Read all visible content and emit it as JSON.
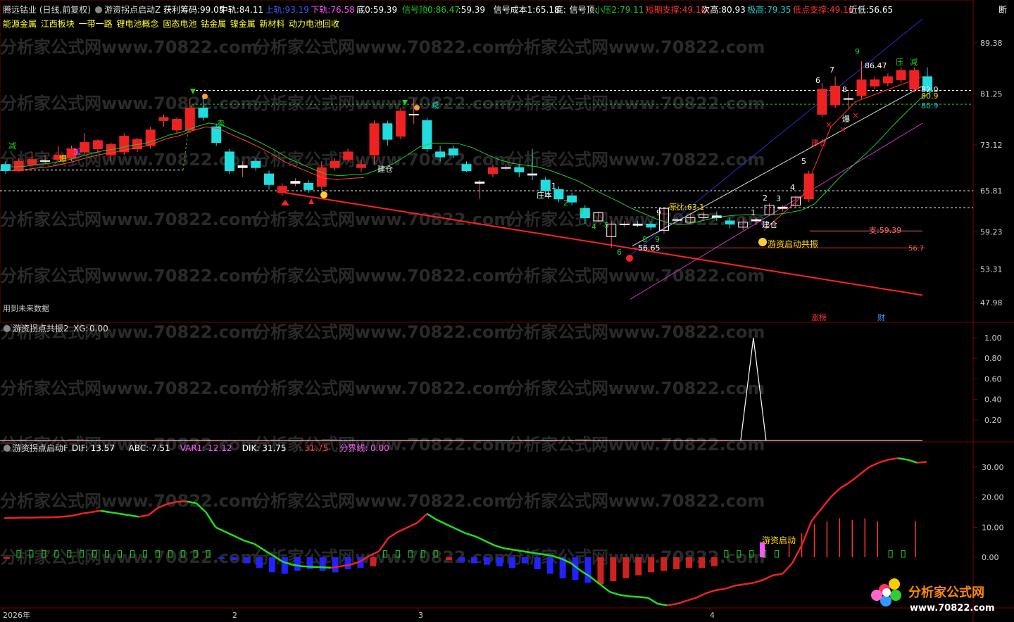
{
  "header": {
    "title": "腾远钴业 (日线,前复权)",
    "indicator_name": "游资拐点启动Z",
    "items": [
      {
        "label": "获利筹码:",
        "value": "99.05",
        "color": "#ffffff"
      },
      {
        "label": "中轨:",
        "value": "84.11",
        "color": "#ffffff"
      },
      {
        "label": "上轨:",
        "value": "93.19",
        "color": "#3b5bff"
      },
      {
        "label": "下轨:",
        "value": "76.58",
        "color": "#ff55ff"
      },
      {
        "label": "底0:",
        "value": "59.39",
        "color": "#ffffff"
      },
      {
        "label": "信号顶0:",
        "value": "86.47",
        "color": "#22cc22"
      },
      {
        "label": ":",
        "value": "59.39",
        "color": "#ffffff"
      },
      {
        "label": "信号成本1:",
        "value": "65.18",
        "color": "#ffffff"
      },
      {
        "label": "底:",
        "value": "",
        "color": "#ffffff"
      },
      {
        "label": "信号顶:",
        "value": "",
        "color": "#ffffff"
      },
      {
        "label": "小压2:",
        "value": "79.11",
        "color": "#22cc22"
      },
      {
        "label": "短期支撑:",
        "value": "49.16",
        "color": "#ff3333"
      },
      {
        "label": "次高:",
        "value": "80.93",
        "color": "#ffffff"
      },
      {
        "label": "极高:",
        "value": "79.35",
        "color": "#22cccc"
      },
      {
        "label": "低点支撑:",
        "value": "49.16",
        "color": "#ff3333"
      },
      {
        "label": "近低:",
        "value": "56.65",
        "color": "#ffffff"
      }
    ],
    "tail": "断"
  },
  "concepts": [
    "能源金属",
    "江西板块",
    "一带一路",
    "锂电池概念",
    "固态电池",
    "钴金属",
    "镍金属",
    "新材料",
    "动力电池回收"
  ],
  "watermark": "分析家公式网www.70822.com",
  "logo": {
    "name": "分析家公式网",
    "url": "www.70822.com"
  },
  "future_note": "用到未来数据",
  "bottom_tags": {
    "zhangbang": "涨榜",
    "cai": "财"
  },
  "panel2": {
    "name": "游资拐点共振2",
    "label": "XG:",
    "value": "0.00"
  },
  "panel3": {
    "name": "游资拐点启动F",
    "items": [
      {
        "label": "DIF:",
        "value": "13.57",
        "color": "#ffffff"
      },
      {
        "label": "ABC:",
        "value": "7.51",
        "color": "#ffffff"
      },
      {
        "label": "VAR1:",
        "value": "12.12",
        "color": "#ff55ff"
      },
      {
        "label": "DIK:",
        "value": "31.75",
        "color": "#ffffff"
      },
      {
        "label": ":",
        "value": "31.75",
        "color": "#ff3333"
      },
      {
        "label": "分界线:",
        "value": "0.00",
        "color": "#ff55ff"
      }
    ]
  },
  "axis": {
    "main_ticks": [
      "89.38",
      "81.25",
      "73.12",
      "65.81",
      "59.23",
      "53.31",
      "47.98"
    ],
    "panel2_ticks": [
      "1.00",
      "0.80",
      "0.60",
      "0.40",
      "0.20"
    ],
    "panel3_ticks": [
      "30.00",
      "20.00",
      "10.00",
      "0.00"
    ],
    "x_labels": [
      "2026年",
      "2",
      "3",
      "4"
    ]
  },
  "annotations": {
    "low_price": "56.65",
    "high_price": "86.47",
    "support": "支:59.39",
    "level_567": "56.7",
    "level_820": "82.0",
    "level_809a": "80.9",
    "level_809b": "80.9",
    "yuanbi": "原比:63.1",
    "yz_resonance": "游资启动共振",
    "yz_start": "游资启动",
    "jiancang1": "建仓",
    "jiancang2": "建仓",
    "jiancang3": "建仓",
    "zhuangben": "庄本",
    "bao1": "爆",
    "bao2": "爆",
    "jian1": "减",
    "jian2": "减",
    "jian3": "减",
    "mai": "卖",
    "ya": "压",
    "jia": "加"
  },
  "chart_data": {
    "type": "candlestick",
    "main_y_range": [
      47.98,
      89.38
    ],
    "candles": [
      {
        "o": 70.0,
        "c": 69.0,
        "h": 70.5,
        "l": 68.5
      },
      {
        "o": 69.0,
        "c": 70.5,
        "h": 71.0,
        "l": 68.8
      },
      {
        "o": 70.0,
        "c": 70.8,
        "h": 72.0,
        "l": 69.5
      },
      {
        "o": 70.5,
        "c": 70.6,
        "h": 71.5,
        "l": 70.0
      },
      {
        "o": 70.8,
        "c": 71.5,
        "h": 73.0,
        "l": 70.5
      },
      {
        "o": 71.0,
        "c": 72.5,
        "h": 73.0,
        "l": 70.5
      },
      {
        "o": 72.0,
        "c": 73.5,
        "h": 75.0,
        "l": 71.5
      },
      {
        "o": 72.5,
        "c": 73.8,
        "h": 74.0,
        "l": 72.0
      },
      {
        "o": 71.5,
        "c": 73.2,
        "h": 73.5,
        "l": 70.5
      },
      {
        "o": 72.0,
        "c": 74.5,
        "h": 75.0,
        "l": 71.5
      },
      {
        "o": 72.5,
        "c": 74.0,
        "h": 74.2,
        "l": 72.0
      },
      {
        "o": 73.0,
        "c": 75.5,
        "h": 76.0,
        "l": 72.5
      },
      {
        "o": 77.0,
        "c": 77.5,
        "h": 78.0,
        "l": 76.0
      },
      {
        "o": 75.5,
        "c": 77.2,
        "h": 77.5,
        "l": 75.0
      },
      {
        "o": 75.5,
        "c": 79.0,
        "h": 80.5,
        "l": 75.0
      },
      {
        "o": 79.0,
        "c": 77.5,
        "h": 80.8,
        "l": 77.0
      },
      {
        "o": 76.0,
        "c": 73.5,
        "h": 76.5,
        "l": 73.0
      },
      {
        "o": 72.0,
        "c": 69.0,
        "h": 72.5,
        "l": 68.5
      },
      {
        "o": 69.5,
        "c": 69.8,
        "h": 70.5,
        "l": 68.0
      },
      {
        "o": 70.5,
        "c": 69.5,
        "h": 71.0,
        "l": 69.0
      },
      {
        "o": 68.5,
        "c": 66.8,
        "h": 69.0,
        "l": 66.0
      },
      {
        "o": 65.5,
        "c": 66.5,
        "h": 67.0,
        "l": 65.0
      },
      {
        "o": 67.0,
        "c": 67.3,
        "h": 67.8,
        "l": 66.5
      },
      {
        "o": 67.0,
        "c": 66.0,
        "h": 67.5,
        "l": 65.5
      },
      {
        "o": 66.5,
        "c": 69.5,
        "h": 70.5,
        "l": 66.0
      },
      {
        "o": 69.5,
        "c": 70.5,
        "h": 71.0,
        "l": 69.0
      },
      {
        "o": 70.8,
        "c": 72.0,
        "h": 72.5,
        "l": 70.5
      },
      {
        "o": 69.5,
        "c": 70.0,
        "h": 70.8,
        "l": 68.8
      },
      {
        "o": 71.5,
        "c": 76.5,
        "h": 77.0,
        "l": 70.0
      },
      {
        "o": 76.5,
        "c": 74.0,
        "h": 77.0,
        "l": 73.0
      },
      {
        "o": 74.5,
        "c": 78.5,
        "h": 79.0,
        "l": 74.0
      },
      {
        "o": 78.0,
        "c": 78.0,
        "h": 80.5,
        "l": 76.5
      },
      {
        "o": 77.0,
        "c": 72.5,
        "h": 77.5,
        "l": 72.0
      },
      {
        "o": 72.0,
        "c": 71.2,
        "h": 73.0,
        "l": 70.5
      },
      {
        "o": 72.5,
        "c": 71.5,
        "h": 73.0,
        "l": 71.0
      },
      {
        "o": 70.0,
        "c": 69.0,
        "h": 70.5,
        "l": 68.8
      },
      {
        "o": 67.0,
        "c": 67.2,
        "h": 67.5,
        "l": 64.5
      },
      {
        "o": 68.5,
        "c": 69.5,
        "h": 70.0,
        "l": 68.0
      },
      {
        "o": 69.5,
        "c": 69.5,
        "h": 70.0,
        "l": 69.0
      },
      {
        "o": 69.5,
        "c": 68.8,
        "h": 70.0,
        "l": 68.0
      },
      {
        "o": 68.5,
        "c": 68.3,
        "h": 72.5,
        "l": 67.5
      },
      {
        "o": 67.5,
        "c": 65.8,
        "h": 68.0,
        "l": 65.0
      },
      {
        "o": 66.0,
        "c": 64.5,
        "h": 66.5,
        "l": 64.0
      },
      {
        "o": 65.0,
        "c": 64.0,
        "h": 65.5,
        "l": 63.5
      },
      {
        "o": 63.0,
        "c": 61.5,
        "h": 63.5,
        "l": 60.5
      },
      {
        "o": 61.0,
        "c": 62.3,
        "h": 62.5,
        "l": 60.8
      },
      {
        "o": 58.5,
        "c": 60.5,
        "h": 61.0,
        "l": 56.65
      },
      {
        "o": 60.5,
        "c": 60.5,
        "h": 61.0,
        "l": 60.0
      },
      {
        "o": 60.5,
        "c": 60.3,
        "h": 61.0,
        "l": 60.0
      },
      {
        "o": 60.5,
        "c": 60.0,
        "h": 61.0,
        "l": 59.5
      },
      {
        "o": 59.5,
        "c": 63.0,
        "h": 63.1,
        "l": 59.0
      },
      {
        "o": 61.2,
        "c": 61.2,
        "h": 61.5,
        "l": 60.8
      },
      {
        "o": 60.8,
        "c": 61.5,
        "h": 62.0,
        "l": 60.5
      },
      {
        "o": 61.5,
        "c": 62.0,
        "h": 62.5,
        "l": 61.0
      },
      {
        "o": 61.8,
        "c": 61.5,
        "h": 62.5,
        "l": 61.0
      },
      {
        "o": 61.0,
        "c": 60.5,
        "h": 61.5,
        "l": 59.8
      },
      {
        "o": 60.0,
        "c": 60.8,
        "h": 61.5,
        "l": 59.5
      },
      {
        "o": 61.0,
        "c": 61.2,
        "h": 61.5,
        "l": 60.5
      },
      {
        "o": 62.0,
        "c": 63.5,
        "h": 63.8,
        "l": 61.8
      },
      {
        "o": 63.0,
        "c": 63.2,
        "h": 63.5,
        "l": 62.5
      },
      {
        "o": 63.5,
        "c": 64.8,
        "h": 65.0,
        "l": 63.0
      },
      {
        "o": 64.5,
        "c": 68.5,
        "h": 69.0,
        "l": 64.0
      },
      {
        "o": 78.0,
        "c": 82.0,
        "h": 83.0,
        "l": 77.5
      },
      {
        "o": 79.5,
        "c": 82.5,
        "h": 84.0,
        "l": 79.0
      },
      {
        "o": 80.5,
        "c": 80.5,
        "h": 81.5,
        "l": 79.0
      },
      {
        "o": 81.0,
        "c": 83.5,
        "h": 86.47,
        "l": 80.5
      },
      {
        "o": 82.5,
        "c": 83.5,
        "h": 84.0,
        "l": 82.0
      },
      {
        "o": 83.0,
        "c": 84.0,
        "h": 84.5,
        "l": 82.5
      },
      {
        "o": 83.5,
        "c": 85.0,
        "h": 85.5,
        "l": 83.0
      },
      {
        "o": 82.0,
        "c": 85.0,
        "h": 85.5,
        "l": 81.5
      },
      {
        "o": 84.0,
        "c": 81.8,
        "h": 85.5,
        "l": 81.5
      }
    ],
    "ma_line": [
      69.6,
      69.7,
      70.0,
      70.2,
      70.6,
      71.1,
      71.7,
      72.2,
      72.5,
      73.0,
      73.3,
      73.9,
      74.7,
      75.2,
      76.0,
      76.6,
      76.3,
      75.3,
      74.4,
      73.4,
      72.3,
      71.0,
      70.1,
      69.2,
      68.4,
      68.2,
      68.4,
      68.5,
      69.3,
      70.1,
      71.4,
      72.8,
      73.4,
      73.4,
      73.3,
      72.7,
      71.7,
      70.8,
      70.2,
      69.9,
      69.6,
      69.0,
      68.2,
      67.4,
      66.3,
      65.2,
      64.2,
      63.1,
      62.2,
      61.3,
      60.6,
      60.4,
      60.8,
      61.3,
      61.7,
      61.9,
      62.0,
      61.9,
      62.0,
      62.3,
      62.7,
      63.7,
      65.9,
      68.1,
      70.0,
      71.9,
      74.0,
      76.3,
      78.4,
      80.4,
      81.8
    ],
    "dik_series": [
      13.0,
      13.1,
      13.2,
      13.2,
      13.3,
      13.3,
      13.5,
      13.8,
      14.5,
      15.0,
      15.5,
      15.0,
      14.5,
      14.0,
      13.5,
      14.0,
      16.5,
      17.8,
      18.5,
      18.6,
      18.0,
      15.0,
      10.0,
      8.5,
      7.0,
      5.5,
      4.5,
      2.5,
      0.5,
      -1.5,
      -2.5,
      -3.0,
      -3.2,
      -3.3,
      -3.5,
      -3.0,
      -2.5,
      -1.5,
      0.5,
      2.0,
      6.5,
      8.5,
      10.0,
      11.5,
      14.5,
      12.5,
      11.0,
      9.5,
      8.0,
      7.0,
      5.5,
      4.0,
      3.0,
      2.5,
      2.0,
      1.5,
      1.0,
      0.5,
      -0.5,
      -2.0,
      -4.5,
      -6.5,
      -9.0,
      -11.5,
      -12.5,
      -13.0,
      -13.2,
      -13.5,
      -15.5,
      -16.0,
      -15.5,
      -14.5,
      -13.5,
      -12.0,
      -11.0,
      -10.5,
      -9.5,
      -9.0,
      -8.5,
      -7.5,
      -6.0,
      -5.5,
      -2.0,
      4.0,
      12.0,
      16.0,
      20.0,
      23.0,
      25.0,
      27.5,
      30.0,
      31.5,
      32.5,
      33.0,
      32.5,
      31.5,
      31.75
    ],
    "macd_bars": [
      -0.5,
      0.8,
      0.9,
      1.0,
      1.0,
      1.8,
      2.5,
      2.0,
      1.5,
      1.0,
      2.0,
      1.5,
      0.8,
      1.0,
      1.3,
      1.0,
      0.5,
      -0.5,
      -1.0,
      -2.0,
      -3.5,
      -5.0,
      -5.5,
      -4.5,
      -4.0,
      -4.5,
      -5.0,
      -4.0,
      -3.5,
      -3.0,
      1.0,
      2.0,
      2.0,
      2.5,
      1.5,
      -1.0,
      -1.5,
      -2.0,
      -2.5,
      -3.0,
      -3.5,
      -2.0,
      -4.0,
      -5.5,
      -7.0,
      -7.5,
      -8.5,
      -9.0,
      -8.0,
      -7.0,
      -6.0,
      -5.0,
      -4.5,
      -4.0,
      -3.5,
      -3.5,
      -3.0,
      2.5,
      2.0,
      1.0,
      1.5,
      3.0,
      6.0,
      8.0,
      11.0,
      12.0,
      13.0,
      12.5,
      13.0,
      12.0,
      1.5,
      2.0,
      12.12
    ],
    "xg_series_peak_index": 57
  }
}
